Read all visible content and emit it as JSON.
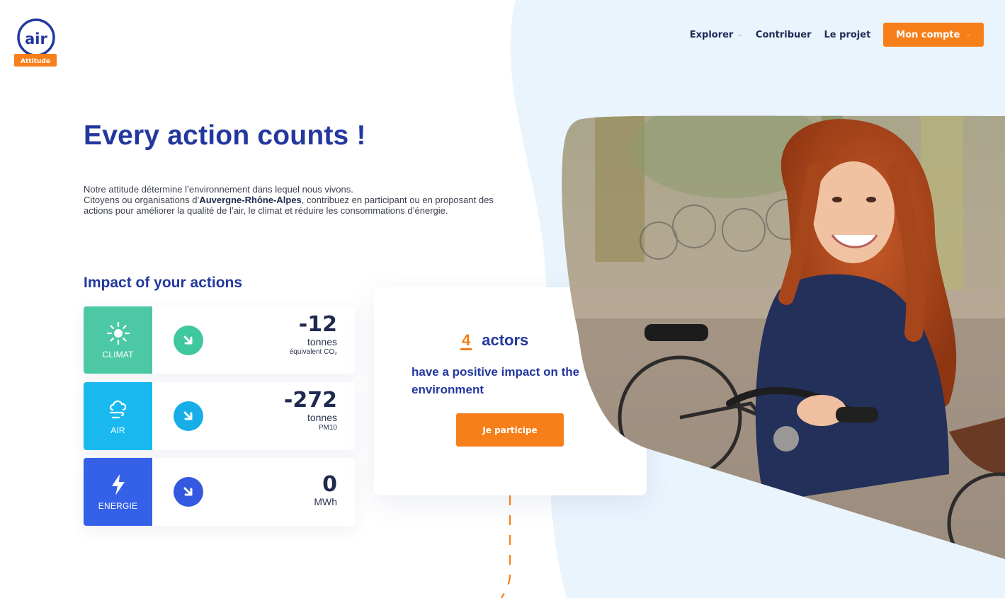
{
  "brand": {
    "logo_text": "air",
    "logo_subtext": "Attitude",
    "color_primary": "#23389e",
    "color_accent": "#f77f1a"
  },
  "nav": {
    "explorer": "Explorer",
    "contribuer": "Contribuer",
    "projet": "Le projet",
    "account": "Mon compte"
  },
  "hero": {
    "title": "Every action counts !",
    "desc_line1": "Notre attitude détermine l’environnement dans lequel nous vivons.",
    "desc_before_region": "Citoyens ou organisations d’",
    "region": "Auvergne-Rhône-Alpes",
    "desc_after_region": ", contribuez en participant ou en proposant des actions pour améliorer la qualité de l’air, le climat et réduire les consommations d’énergie."
  },
  "impact": {
    "title": "Impact of your actions",
    "cards": [
      {
        "label": "CLIMAT",
        "icon": "sun-icon",
        "color": "#4cc9a4",
        "trend_color": "#3fc79d",
        "value": "-12",
        "unit": "tonnes",
        "sub": "équivalent CO₂"
      },
      {
        "label": "AIR",
        "icon": "wind-cloud-icon",
        "color": "#19b9f0",
        "trend_color": "#17aee8",
        "value": "-272",
        "unit": "tonnes",
        "sub": "PM10"
      },
      {
        "label": "ENERGIE",
        "icon": "lightning-icon",
        "color": "#3561e8",
        "trend_color": "#3458e0",
        "value": "0",
        "unit": "MWh",
        "sub": ""
      }
    ]
  },
  "actors": {
    "count": "4",
    "label": "actors",
    "desc": "have a positive impact on the environment",
    "button": "Je participe"
  }
}
